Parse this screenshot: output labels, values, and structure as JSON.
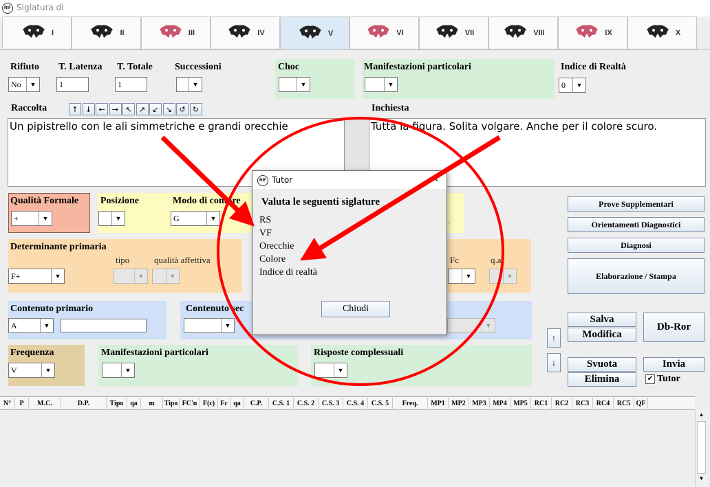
{
  "window": {
    "title": "Siglatura di",
    "logo": "RIF"
  },
  "tabs": [
    {
      "label": "I"
    },
    {
      "label": "II"
    },
    {
      "label": "III"
    },
    {
      "label": "IV"
    },
    {
      "label": "V"
    },
    {
      "label": "VI"
    },
    {
      "label": "VII"
    },
    {
      "label": "VIII"
    },
    {
      "label": "IX"
    },
    {
      "label": "X"
    }
  ],
  "row1": {
    "rifiuto": {
      "label": "Rifiuto",
      "value": "No"
    },
    "t_latenza": {
      "label": "T. Latenza",
      "value": "1"
    },
    "t_totale": {
      "label": "T. Totale",
      "value": "1"
    },
    "successioni": {
      "label": "Successioni",
      "value": ""
    },
    "choc": {
      "label": "Choc",
      "value": ""
    },
    "manifestazioni": {
      "label": "Manifestazioni particolari",
      "value": ""
    },
    "indice_realta": {
      "label": "Indice di Realtà",
      "value": "0"
    }
  },
  "raccolta": {
    "label": "Raccolta",
    "text": "Un pipistrello con le ali simmetriche e grandi orecchie",
    "arrows": [
      "↑",
      "↓",
      "←",
      "→",
      "↖",
      "↗",
      "↙",
      "↘",
      "↺",
      "↻"
    ]
  },
  "inchiesta": {
    "label": "Inchiesta",
    "text": "Tutta la figura. Solita volgare. Anche per il colore scuro."
  },
  "row3": {
    "qualita_formale": {
      "label": "Qualità Formale",
      "value": "+"
    },
    "posizione": {
      "label": "Posizione",
      "value": ""
    },
    "modo": {
      "label": "Modo di compre",
      "value": "G"
    }
  },
  "determinante": {
    "label": "Determinante primaria",
    "value": "F+",
    "tipo_label": "tipo",
    "qa_label": "qualità affettiva"
  },
  "fc_panel": {
    "fc_label": "Fc",
    "qa_label": "q.a."
  },
  "contenuto": {
    "label": "Contenuto primario",
    "value": "A",
    "sec_label": "Contenuto sec"
  },
  "row6": {
    "frequenza": {
      "label": "Frequenza",
      "value": "V"
    },
    "manifestazioni": {
      "label": "Manifestazioni particolari"
    },
    "risposte": {
      "label": "Risposte complessuali"
    }
  },
  "buttons": {
    "prove": "Prove Supplementari",
    "orientamenti": "Orientamenti Diagnostici",
    "diagnosi": "Diagnosi",
    "elaborazione": "Elaborazione / Stampa",
    "salva": "Salva",
    "modifica": "Modifica",
    "dbror": "Db-Ror",
    "svuota": "Svuota",
    "elimina": "Elimina",
    "invia": "Invia",
    "tutor": "Tutor",
    "up": "↑",
    "down": "↓"
  },
  "table": {
    "columns": [
      "N°",
      "P",
      "M.C.",
      "D.P.",
      "Tipo",
      "qa",
      "m",
      "Tipo",
      "FC'n",
      "F(c)",
      "Fc",
      "qa",
      "C.P.",
      "C.S. 1",
      "C.S. 2",
      "C.S. 3",
      "C.S. 4",
      "C.S. 5",
      "Freq.",
      "MP1",
      "MP2",
      "MP3",
      "MP4",
      "MP5",
      "RC1",
      "RC2",
      "RC3",
      "RC4",
      "RC5",
      "QF"
    ]
  },
  "dialog": {
    "title": "Tutor",
    "heading": "Valuta le seguenti siglature",
    "items": [
      "RS",
      "VF",
      "Orecchie",
      "Colore",
      "Indice di realtà"
    ],
    "close": "Chiudi",
    "x": "✕"
  },
  "colors": {
    "green_panel": "#d6efd8",
    "blue_panel": "#cfe0f8",
    "orange_panel": "#fcdcae",
    "yellow_panel": "#fdfbbe",
    "salmon_panel": "#f6b6a0",
    "tan_panel": "#e2cfa2",
    "annotation": "#ff0000"
  }
}
